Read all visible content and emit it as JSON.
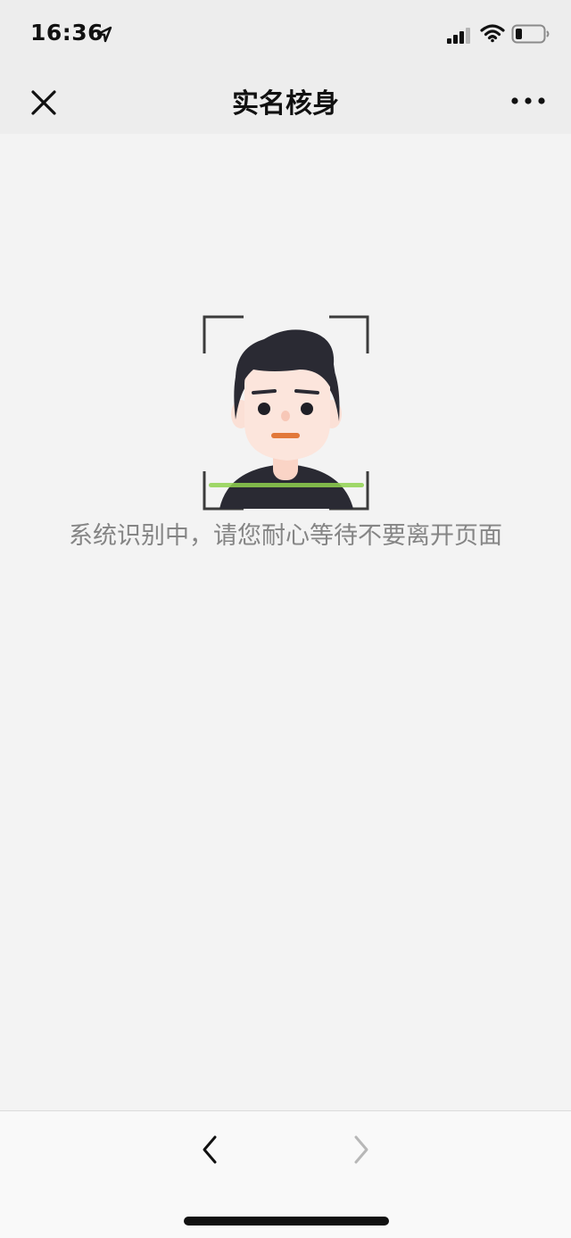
{
  "status_bar": {
    "time": "16:36",
    "icons": [
      "location-arrow-icon",
      "cellular-signal-icon",
      "wifi-icon",
      "battery-icon"
    ]
  },
  "nav": {
    "title": "实名核身",
    "close_icon": "close-icon",
    "more_icon": "more-dots-icon"
  },
  "main": {
    "illustration": "face-scan-avatar",
    "message": "系统识别中，请您耐心等待不要离开页面"
  },
  "toolbar": {
    "back_icon": "chevron-left-icon",
    "forward_icon": "chevron-right-icon",
    "forward_enabled": false
  },
  "colors": {
    "background": "#f3f3f3",
    "bar_background": "#ededed",
    "message_text": "#858585",
    "scan_line": "#8fd14f",
    "hair": "#2a2a33",
    "skin": "#fce5dc",
    "mouth": "#e2783a"
  }
}
